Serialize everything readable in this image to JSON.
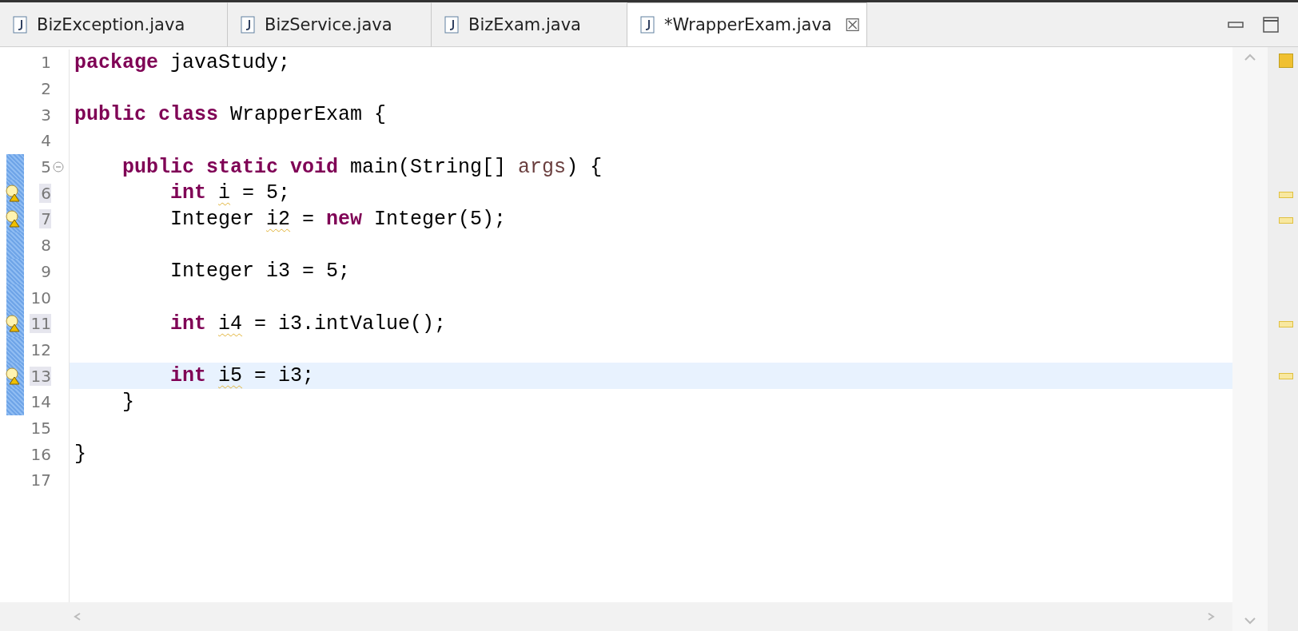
{
  "tabs": [
    {
      "label": "BizException.java",
      "selected": false
    },
    {
      "label": "BizService.java",
      "selected": false
    },
    {
      "label": "BizExam.java",
      "selected": false
    },
    {
      "label": "*WrapperExam.java",
      "selected": true,
      "close": "☒"
    }
  ],
  "lines": [
    {
      "number": "1",
      "changed": false,
      "warning": false,
      "current": false,
      "tokens": [
        {
          "text": "package",
          "kind": "keyword"
        },
        {
          "text": " javaStudy;",
          "kind": "plain"
        }
      ]
    },
    {
      "number": "2",
      "changed": false,
      "warning": false,
      "current": false
    },
    {
      "number": "3",
      "changed": false,
      "warning": false,
      "current": false,
      "tokens": [
        {
          "text": "public class",
          "kind": "keyword"
        },
        {
          "text": " WrapperExam {",
          "kind": "plain"
        }
      ]
    },
    {
      "number": "4",
      "changed": false,
      "warning": false,
      "current": false
    },
    {
      "number": "5",
      "changed": true,
      "warning": false,
      "current": false,
      "foldable": true,
      "tokens": [
        {
          "text": "    public static void",
          "kind": "keyword"
        },
        {
          "text": " main(String[] ",
          "kind": "plain"
        },
        {
          "text": "args",
          "kind": "param"
        },
        {
          "text": ") {",
          "kind": "plain"
        }
      ]
    },
    {
      "number": "6",
      "changed": true,
      "warning": true,
      "current": false,
      "tokens": [
        {
          "text": "        int ",
          "kind": "keyword"
        },
        {
          "text": "i",
          "kind": "warned"
        },
        {
          "text": " = 5;",
          "kind": "plain"
        }
      ]
    },
    {
      "number": "7",
      "changed": true,
      "warning": true,
      "current": false,
      "tokens": [
        {
          "text": "        Integer ",
          "kind": "plain"
        },
        {
          "text": "i2",
          "kind": "warned"
        },
        {
          "text": " = ",
          "kind": "plain"
        },
        {
          "text": "new",
          "kind": "keyword"
        },
        {
          "text": " Integer(5);",
          "kind": "plain"
        }
      ]
    },
    {
      "number": "8",
      "changed": true,
      "warning": false,
      "current": false
    },
    {
      "number": "9",
      "changed": true,
      "warning": false,
      "current": false,
      "tokens": [
        {
          "text": "        Integer i3 = 5;",
          "kind": "plain"
        }
      ]
    },
    {
      "number": "10",
      "changed": true,
      "warning": false,
      "current": false
    },
    {
      "number": "11",
      "changed": true,
      "warning": true,
      "current": false,
      "tokens": [
        {
          "text": "        int ",
          "kind": "keyword"
        },
        {
          "text": "i4",
          "kind": "warned"
        },
        {
          "text": " = i3.intValue();",
          "kind": "plain"
        }
      ]
    },
    {
      "number": "12",
      "changed": true,
      "warning": false,
      "current": false
    },
    {
      "number": "13",
      "changed": true,
      "warning": true,
      "current": true,
      "tokens": [
        {
          "text": "        int ",
          "kind": "keyword"
        },
        {
          "text": "i5",
          "kind": "warned"
        },
        {
          "text": " = i3;",
          "kind": "plain"
        }
      ]
    },
    {
      "number": "14",
      "changed": true,
      "warning": false,
      "current": false,
      "tokens": [
        {
          "text": "    }",
          "kind": "plain"
        }
      ]
    },
    {
      "number": "15",
      "changed": false,
      "warning": false,
      "current": false
    },
    {
      "number": "16",
      "changed": false,
      "warning": false,
      "current": false,
      "tokens": [
        {
          "text": "}",
          "kind": "plain"
        }
      ]
    },
    {
      "number": "17",
      "changed": false,
      "warning": false,
      "current": false
    }
  ]
}
